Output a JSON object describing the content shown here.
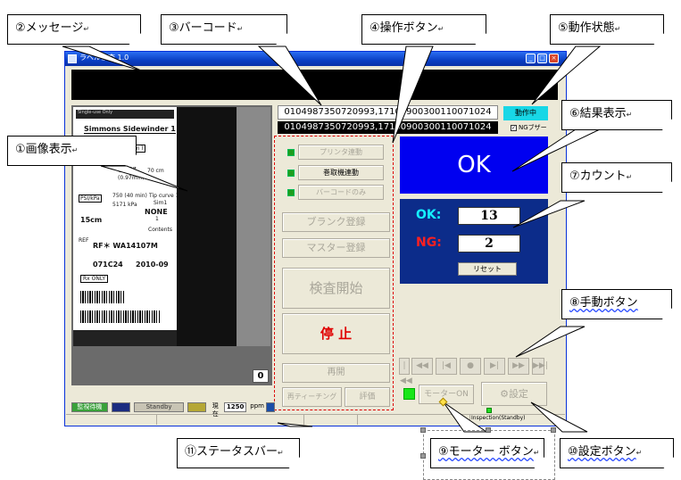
{
  "window": {
    "title": "ラベル検査 1.0",
    "icon": "app-icon",
    "controls": [
      "_",
      "□",
      "×"
    ]
  },
  "image_panel": {
    "counter": "0",
    "label_lines": {
      "header": "Single-use Only",
      "brand": "Simmons Sidewinder 1",
      "size": "( 1.40 mm )",
      "length": "038\"",
      "length_mm": "(0.97mm)",
      "l_value": "70 cm",
      "psi": "PSI/kPa",
      "psi_val": "750 (40 min)",
      "psi_max": "5171 kPa",
      "tip": "Tip curve 1",
      "tip_val": "Sim1",
      "none": "NONE",
      "len_15": "15cm",
      "contents": "1",
      "contents_label": "Contents",
      "ref_label": "REF",
      "ref": "RF＊ WA14107M",
      "lot_num": "071C24",
      "date": "2010-09",
      "rx": "Rx ONLY"
    }
  },
  "barcode": {
    "line1": "0104987350720993,17100900300110071024",
    "line2": "0104987350720993,17100900300110071024"
  },
  "status": {
    "running": "動作中",
    "ng_buzzer_label": "NGブザー",
    "ng_buzzer_checked": "✓"
  },
  "operations": {
    "print_link": "プリンタ連動",
    "winder_link": "巻取機連動",
    "barcode_only": "バーコードのみ",
    "blank_register": "ブランク登録",
    "master_register": "マスター登録",
    "start": "検査開始",
    "stop": "停 止",
    "resume": "再開",
    "reteach": "再ティーチング",
    "evaluate": "評価"
  },
  "result": {
    "value": "OK",
    "color": "#0000f0"
  },
  "count": {
    "ok_label": "OK:",
    "ok_value": "13",
    "ng_label": "NG:",
    "ng_value": "2",
    "reset": "リセット"
  },
  "manual_buttons": [
    "|◀◀",
    "◀◀",
    "|◀",
    "●",
    "▶|",
    "▶▶",
    "▶▶|"
  ],
  "motor": {
    "label": "モーターON"
  },
  "settings": {
    "label": "設定",
    "icon": "gear-icon"
  },
  "status_bar": {
    "mode": "監視待機",
    "standby": "Standby",
    "current_label": "現在",
    "current_value": "1250",
    "unit": "ppm",
    "inspection": "Inspection(Standby)"
  },
  "callouts": {
    "c1": "①画像表示",
    "c2": "②メッセージ",
    "c3": "③バーコード",
    "c4": "④操作ボタン",
    "c5": "⑤動作状態",
    "c6": "⑥結果表示",
    "c7": "⑦カウント",
    "c8": "⑧手動ボタン",
    "c9": "⑨モーター ボタン",
    "c10": "⑩設定ボタン",
    "c11": "⑪ステータスバー"
  },
  "colors": {
    "result_bg": "#0000f0",
    "count_bg": "#0c2c8a",
    "running_bg": "#18d7e6",
    "ng_color": "#ff2020",
    "ok_color": "#14f0ff",
    "stop_color": "#e00000"
  }
}
